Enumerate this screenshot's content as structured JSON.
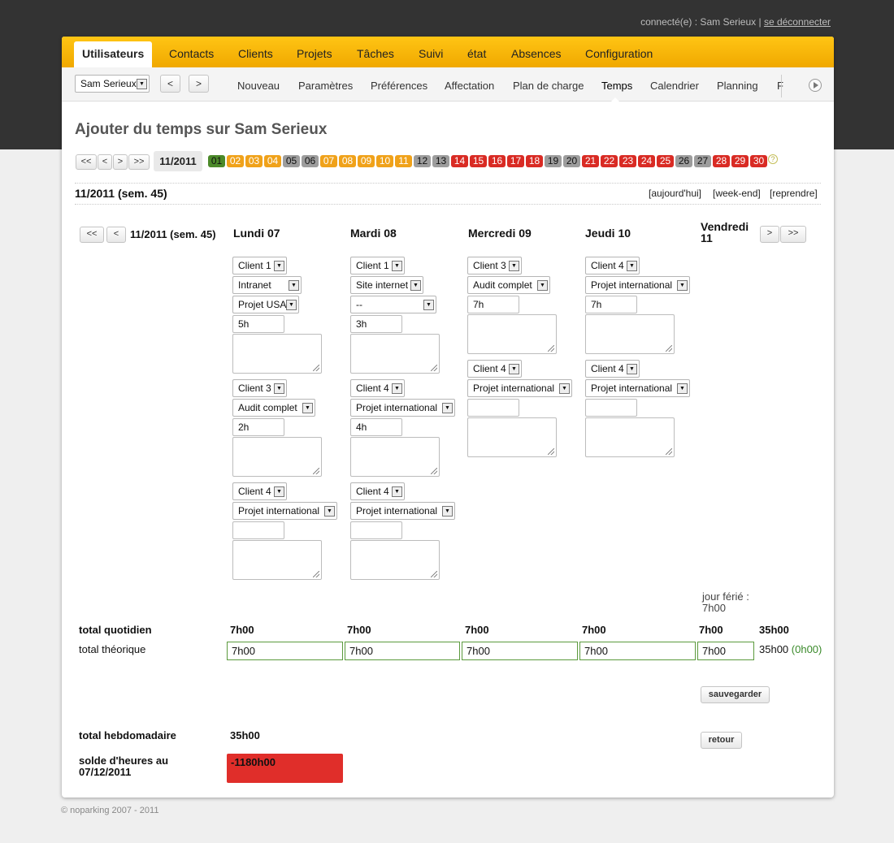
{
  "header": {
    "connected_label": "connecté(e) : Sam Serieux |",
    "logout_label": "se déconnecter"
  },
  "main_nav": [
    {
      "label": "Utilisateurs",
      "active": true
    },
    {
      "label": "Contacts"
    },
    {
      "label": "Clients"
    },
    {
      "label": "Projets"
    },
    {
      "label": "Tâches"
    },
    {
      "label": "Suivi"
    },
    {
      "label": "état"
    },
    {
      "label": "Absences"
    },
    {
      "label": "Configuration"
    }
  ],
  "subnav": {
    "user_select": "Sam Serieux",
    "prev_label": "<",
    "next_label": ">",
    "links": [
      "Nouveau",
      "Paramètres",
      "Préférences",
      "Affectation",
      "Plan de charge",
      "Temps",
      "Calendrier",
      "Planning",
      "F"
    ],
    "active_link": "Temps"
  },
  "page": {
    "title": "Ajouter du temps sur Sam Serieux"
  },
  "month_nav": {
    "first": "<<",
    "prev": "<",
    "next": ">",
    "last": ">>",
    "label": "11/2011",
    "days": [
      {
        "n": "01",
        "s": "green"
      },
      {
        "n": "02",
        "s": "orange"
      },
      {
        "n": "03",
        "s": "orange"
      },
      {
        "n": "04",
        "s": "orange"
      },
      {
        "n": "05",
        "s": "gray"
      },
      {
        "n": "06",
        "s": "gray"
      },
      {
        "n": "07",
        "s": "orange"
      },
      {
        "n": "08",
        "s": "orange"
      },
      {
        "n": "09",
        "s": "orange"
      },
      {
        "n": "10",
        "s": "orange"
      },
      {
        "n": "11",
        "s": "orange"
      },
      {
        "n": "12",
        "s": "gray"
      },
      {
        "n": "13",
        "s": "gray"
      },
      {
        "n": "14",
        "s": "red"
      },
      {
        "n": "15",
        "s": "red"
      },
      {
        "n": "16",
        "s": "red"
      },
      {
        "n": "17",
        "s": "red"
      },
      {
        "n": "18",
        "s": "red"
      },
      {
        "n": "19",
        "s": "gray"
      },
      {
        "n": "20",
        "s": "gray"
      },
      {
        "n": "21",
        "s": "red"
      },
      {
        "n": "22",
        "s": "red"
      },
      {
        "n": "23",
        "s": "red"
      },
      {
        "n": "24",
        "s": "red"
      },
      {
        "n": "25",
        "s": "red"
      },
      {
        "n": "26",
        "s": "gray"
      },
      {
        "n": "27",
        "s": "gray"
      },
      {
        "n": "28",
        "s": "red"
      },
      {
        "n": "29",
        "s": "red"
      },
      {
        "n": "30",
        "s": "red"
      }
    ],
    "help": "?"
  },
  "week": {
    "heading": "11/2011 (sem. 45)",
    "links": [
      "[aujourd'hui]",
      "[week-end]",
      "[reprendre]"
    ],
    "nav_first": "<<",
    "nav_prev": "<",
    "nav_next": ">",
    "nav_last": ">>",
    "nav_label": "11/2011 (sem. 45)"
  },
  "days": [
    {
      "name": "Lundi 07",
      "entries": [
        {
          "client": "Client 1",
          "project": "Intranet",
          "task": "Projet USA",
          "hours": "5h"
        },
        {
          "client": "Client 3",
          "project": "Audit complet",
          "hours": "2h"
        },
        {
          "client": "Client 4",
          "project": "Projet international",
          "hours": ""
        }
      ],
      "daily_total": "7h00",
      "theoretical": "7h00"
    },
    {
      "name": "Mardi 08",
      "entries": [
        {
          "client": "Client 1",
          "project": "Site internet",
          "task": "--",
          "hours": "3h"
        },
        {
          "client": "Client 4",
          "project": "Projet international",
          "hours": "4h"
        },
        {
          "client": "Client 4",
          "project": "Projet international",
          "hours": ""
        }
      ],
      "daily_total": "7h00",
      "theoretical": "7h00"
    },
    {
      "name": "Mercredi 09",
      "entries": [
        {
          "client": "Client 3",
          "project": "Audit complet",
          "hours": "7h"
        },
        {
          "client": "Client 4",
          "project": "Projet international",
          "hours": ""
        }
      ],
      "daily_total": "7h00",
      "theoretical": "7h00"
    },
    {
      "name": "Jeudi 10",
      "entries": [
        {
          "client": "Client 4",
          "project": "Projet international",
          "hours": "7h"
        },
        {
          "client": "Client 4",
          "project": "Projet international",
          "hours": ""
        }
      ],
      "daily_total": "7h00",
      "theoretical": "7h00"
    },
    {
      "name": "Vendredi 11",
      "holiday": "jour férié : 7h00",
      "daily_total": "7h00",
      "theoretical": "7h00"
    }
  ],
  "totals": {
    "daily_label": "total quotidien",
    "theoretical_label": "total théorique",
    "daily_sum": "35h00",
    "theoretical_sum": "35h00",
    "theoretical_diff": "(0h00)",
    "weekly_label": "total hebdomadaire",
    "weekly_value": "35h00",
    "balance_label": "solde d'heures au 07/12/2011",
    "balance_value": "-1180h00"
  },
  "actions": {
    "save": "sauvegarder",
    "back": "retour"
  },
  "footer": "© noparking 2007 - 2011",
  "colors": {
    "accent": "#f6b300",
    "green_day": "#4c8a2a",
    "orange_day": "#f0a21a",
    "gray_day": "#9d9d9d",
    "red_day": "#d92b24",
    "balance_bg": "#e02e2a"
  }
}
